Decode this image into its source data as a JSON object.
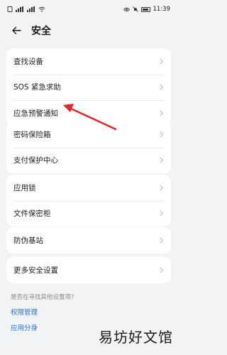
{
  "status_bar": {
    "left_icons": [
      "sim-icon",
      "signal-icon",
      "signal-icon",
      "wifi-icon"
    ],
    "right_icons": [
      "eye-icon",
      "mute-icon",
      "battery-icon"
    ],
    "time": "11:39"
  },
  "header": {
    "back_icon": "arrow-left-icon",
    "title": "安全"
  },
  "groups": [
    {
      "items": [
        "查找设备",
        "SOS 紧急求助",
        "应急预警通知"
      ]
    },
    {
      "items": [
        "密码保险箱",
        "支付保护中心"
      ]
    },
    {
      "items": [
        "应用锁",
        "文件保密柜"
      ]
    },
    {
      "items": [
        "防伪基站"
      ]
    },
    {
      "items": [
        "更多安全设置"
      ]
    }
  ],
  "suggestions": {
    "question": "是否在寻找其他设置项?",
    "links": [
      "权限管理",
      "应用分身"
    ]
  },
  "annotation": {
    "color": "#e2262c"
  },
  "watermark": "易坊好文馆",
  "colors": {
    "background": "#f1f3f5",
    "card": "#ffffff",
    "link": "#2a6fdb"
  }
}
